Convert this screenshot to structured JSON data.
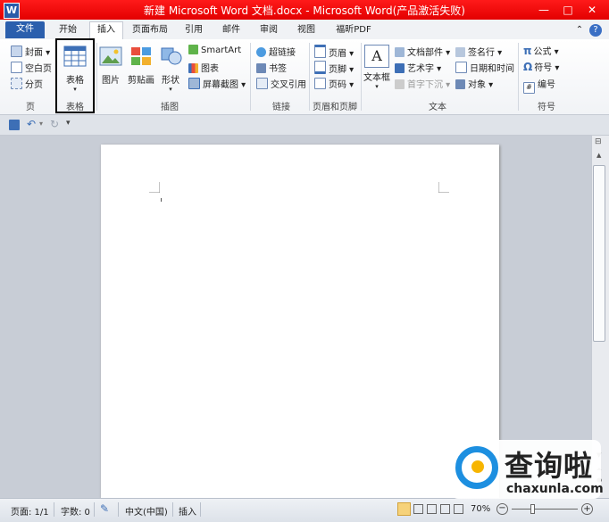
{
  "window": {
    "title": "新建 Microsoft Word 文档.docx - Microsoft Word(产品激活失败)",
    "logo_letter": "W",
    "controls": {
      "minimize": "—",
      "maximize": "□",
      "close": "✕"
    }
  },
  "tabs": {
    "file": "文件",
    "items": [
      "开始",
      "插入",
      "页面布局",
      "引用",
      "邮件",
      "审阅",
      "视图",
      "福昕PDF"
    ],
    "active": "插入",
    "help": "?"
  },
  "ribbon": {
    "pages": {
      "label": "页",
      "items": [
        "封面",
        "空白页",
        "分页"
      ]
    },
    "tables": {
      "label": "表格",
      "button": "表格"
    },
    "illustrations": {
      "label": "插图",
      "picture": "图片",
      "clipart": "剪贴画",
      "shapes": "形状",
      "smartart": "SmartArt",
      "chart": "图表",
      "screenshot": "屏幕截图"
    },
    "links": {
      "label": "链接",
      "items": [
        "超链接",
        "书签",
        "交叉引用"
      ]
    },
    "header_footer": {
      "label": "页眉和页脚",
      "items": [
        "页眉",
        "页脚",
        "页码"
      ]
    },
    "text": {
      "label": "文本",
      "textbox": "文本框",
      "textbox_letter": "A",
      "items": [
        "文档部件",
        "艺术字",
        "首字下沉",
        "签名行",
        "日期和时间",
        "对象"
      ]
    },
    "symbols": {
      "label": "符号",
      "items": [
        "公式",
        "符号",
        "编号"
      ],
      "glyphs": [
        "π",
        "Ω",
        "#"
      ]
    }
  },
  "status": {
    "page": "页面: 1/1",
    "words": "字数: 0",
    "language": "中文(中国)",
    "mode": "插入",
    "zoom": "70%"
  },
  "watermark": {
    "brand": "查询啦",
    "url": "chaxunla.com"
  },
  "colors": {
    "title_bar": "#e30000",
    "file_tab": "#2b5fad",
    "accent": "#1d8fe0"
  }
}
